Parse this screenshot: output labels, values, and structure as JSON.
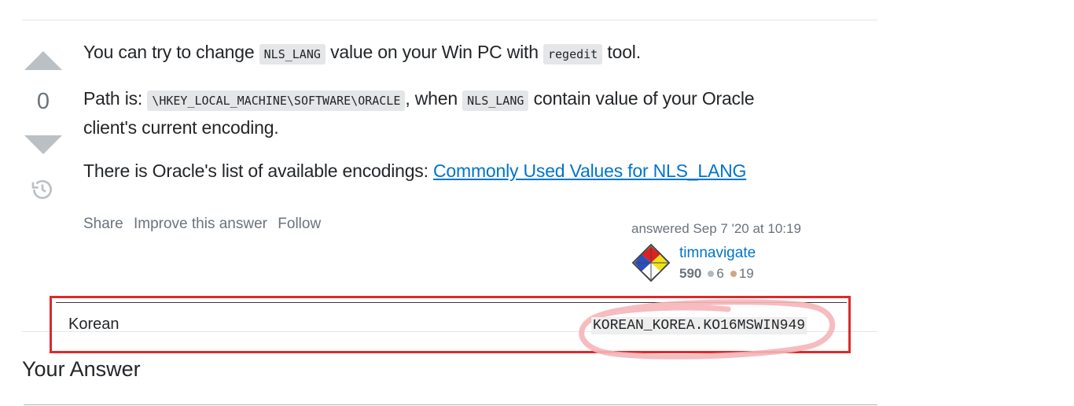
{
  "vote": {
    "count": "0"
  },
  "post": {
    "p1": {
      "t1": "You can try to change ",
      "c1": "NLS_LANG",
      "t2": " value on your Win PC with ",
      "c2": "regedit",
      "t3": " tool."
    },
    "p2": {
      "t1": "Path is: ",
      "c1": "\\HKEY_LOCAL_MACHINE\\SOFTWARE\\ORACLE",
      "t2": ", when ",
      "c2": "NLS_LANG",
      "t3": " contain value of your Oracle",
      "t4": "client's current encoding."
    },
    "p3": {
      "t1": "There is Oracle's list of available encodings: ",
      "link": "Commonly Used Values for NLS_LANG"
    }
  },
  "menu": {
    "share": "Share",
    "improve": "Improve this answer",
    "follow": "Follow"
  },
  "author": {
    "answered": "answered Sep 7 '20 at 10:19",
    "name": "timnavigate",
    "reputation": "590",
    "silver": "6",
    "bronze": "19",
    "silver_color": "#b4b8bc",
    "bronze_color": "#d1a684"
  },
  "annotation": {
    "language": "Korean",
    "nls_value": "KOREAN_KOREA.KO16MSWIN949",
    "box_color": "#dd2a2a"
  },
  "your_answer": {
    "title": "Your Answer"
  }
}
